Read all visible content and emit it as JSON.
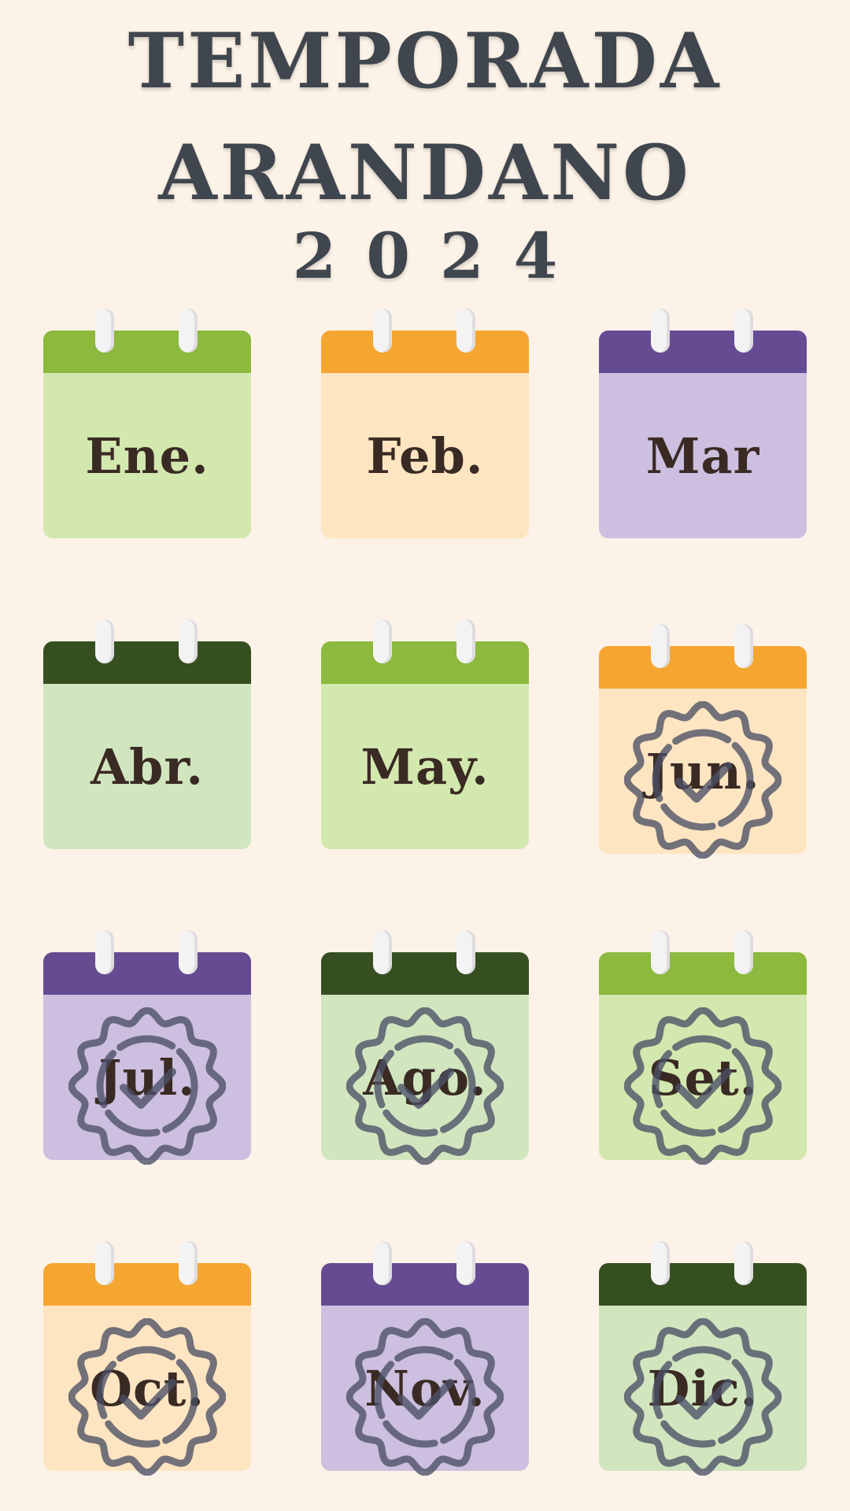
{
  "title": {
    "line1": "TEMPORADA",
    "line2": "ARANDANO",
    "year": "2024"
  },
  "colors": {
    "background": "#fcf2e7",
    "title": "#40464e",
    "label": "#3a2a24",
    "badge": "#4b5066"
  },
  "months": [
    {
      "label": "Ene.",
      "header": "#8cb93e",
      "body": "#d3e8ae",
      "checked": false
    },
    {
      "label": "Feb.",
      "header": "#f5a631",
      "body": "#fee5c1",
      "checked": false
    },
    {
      "label": "Mar",
      "header": "#654c92",
      "body": "#cdbfdf",
      "checked": false
    },
    {
      "label": "Abr.",
      "header": "#354f21",
      "body": "#d1e6bf",
      "checked": false
    },
    {
      "label": "May.",
      "header": "#8cb93e",
      "body": "#d3e8ae",
      "checked": false
    },
    {
      "label": "Jun.",
      "header": "#f5a631",
      "body": "#fee5c1",
      "checked": true
    },
    {
      "label": "Jul.",
      "header": "#654c92",
      "body": "#cdbfdf",
      "checked": true
    },
    {
      "label": "Ago.",
      "header": "#354f21",
      "body": "#d1e6bf",
      "checked": true
    },
    {
      "label": "Set.",
      "header": "#8cb93e",
      "body": "#d3e8ae",
      "checked": true
    },
    {
      "label": "Oct.",
      "header": "#f5a631",
      "body": "#fee5c1",
      "checked": true
    },
    {
      "label": "Nov.",
      "header": "#654c92",
      "body": "#cdbfdf",
      "checked": true
    },
    {
      "label": "Dic.",
      "header": "#354f21",
      "body": "#d1e6bf",
      "checked": true
    }
  ]
}
